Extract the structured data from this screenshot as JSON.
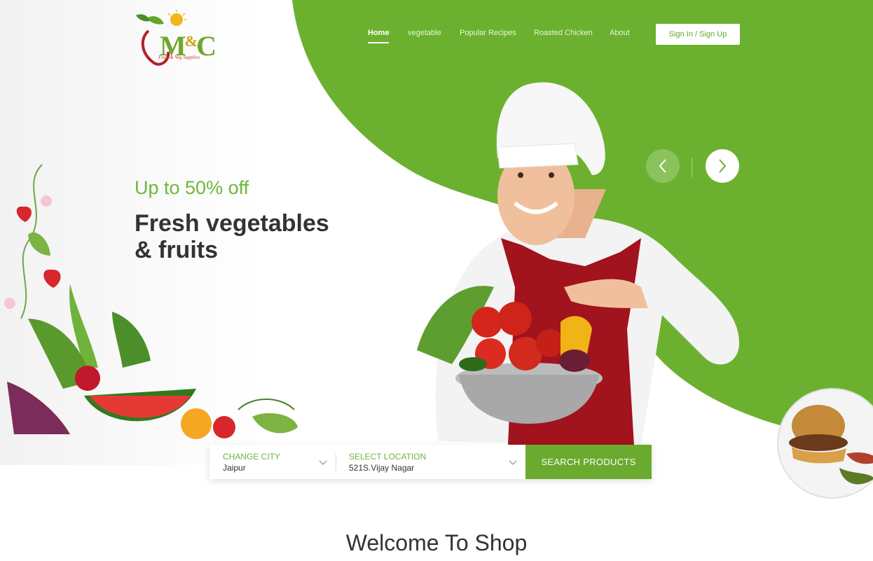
{
  "brand": {
    "logo_text": "M&C",
    "logo_letter_1": "M",
    "logo_amp": "&",
    "logo_letter_2": "C",
    "tagline": "Fruit & Veg Supplies"
  },
  "nav": {
    "items": [
      {
        "label": "Home",
        "active": true
      },
      {
        "label": "vegetable",
        "active": false
      },
      {
        "label": "Popular Recipes",
        "active": false
      },
      {
        "label": "Roasted Chicken",
        "active": false
      },
      {
        "label": "About",
        "active": false
      }
    ],
    "signin_label": "Sign In / Sign Up"
  },
  "hero": {
    "offer": "Up to 50% off",
    "headline_line1": "Fresh vegetables",
    "headline_line2": "& fruits",
    "prev_icon": "chevron-left-icon",
    "next_icon": "chevron-right-icon"
  },
  "search": {
    "city_label": "CHANGE CITY",
    "city_value": "Jaipur",
    "location_label": "SELECT LOCATION",
    "location_value": "521S.Vijay Nagar",
    "button_label": "SEARCH PRODUCTS"
  },
  "section": {
    "welcome_title": "Welcome To Shop"
  },
  "colors": {
    "accent_green": "#6aaa2e",
    "hero_green": "#6bb12f",
    "text_dark": "#333333"
  }
}
